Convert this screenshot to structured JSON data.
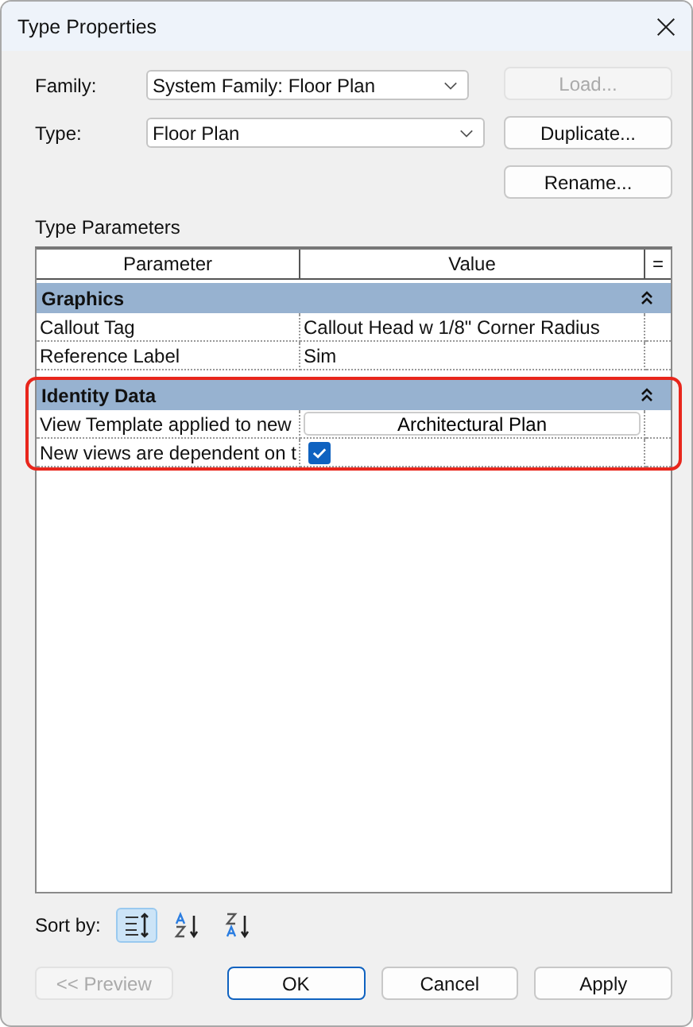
{
  "window": {
    "title": "Type Properties"
  },
  "family": {
    "label": "Family:",
    "value": "System Family: Floor Plan"
  },
  "type": {
    "label": "Type:",
    "value": "Floor Plan"
  },
  "side_buttons": [
    {
      "label": "Load...",
      "disabled": true
    },
    {
      "label": "Duplicate...",
      "disabled": false
    },
    {
      "label": "Rename...",
      "disabled": false
    }
  ],
  "section_label": "Type Parameters",
  "table": {
    "columns": [
      "Parameter",
      "Value",
      "="
    ],
    "groups": [
      {
        "name": "Graphics",
        "expanded": true,
        "highlighted": false,
        "rows": [
          {
            "kind": "text",
            "parameter": "Callout Tag",
            "value": "Callout Head w 1/8\" Corner Radius"
          },
          {
            "kind": "text",
            "parameter": "Reference Label",
            "value": "Sim"
          }
        ]
      },
      {
        "name": "Identity Data",
        "expanded": true,
        "highlighted": true,
        "rows": [
          {
            "kind": "button",
            "parameter": "View Template applied to new",
            "value": "Architectural Plan"
          },
          {
            "kind": "checkbox",
            "parameter": "New views are dependent on t",
            "checked": true
          }
        ]
      }
    ]
  },
  "sort": {
    "label": "Sort by:",
    "options": [
      {
        "kind": "grouped",
        "selected": true
      },
      {
        "kind": "ascending",
        "selected": false
      },
      {
        "kind": "descending",
        "selected": false
      }
    ]
  },
  "footer_buttons": [
    {
      "label": "<< Preview",
      "disabled": true,
      "default": false
    },
    {
      "label": "OK",
      "disabled": false,
      "default": true
    },
    {
      "label": "Cancel",
      "disabled": false,
      "default": false
    },
    {
      "label": "Apply",
      "disabled": false,
      "default": false
    }
  ]
}
